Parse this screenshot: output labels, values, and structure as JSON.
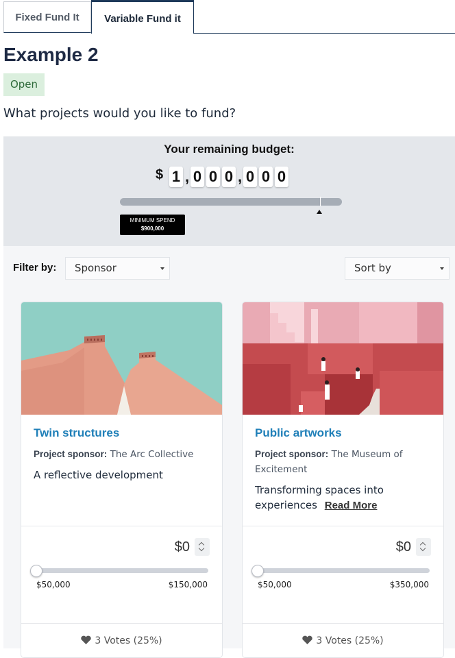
{
  "tabs": [
    {
      "label": "Fixed Fund It",
      "active": false
    },
    {
      "label": "Variable Fund it",
      "active": true
    }
  ],
  "page": {
    "title": "Example 2",
    "status": "Open",
    "question": "What projects would you like to fund?"
  },
  "budget": {
    "title": "Your remaining budget:",
    "currency": "$",
    "digits": [
      "1",
      ",",
      "0",
      "0",
      "0",
      ",",
      "0",
      "0",
      "0"
    ],
    "min_spend_label": "MINIMUM SPEND",
    "min_spend_value": "$900,000",
    "min_spend_fraction": 0.9
  },
  "filters": {
    "label": "Filter by:",
    "sponsor": "Sponsor",
    "sort": "Sort by"
  },
  "projects": [
    {
      "title": "Twin structures",
      "sponsor_label": "Project sponsor:",
      "sponsor": "The Arc Collective",
      "description": "A reflective development",
      "read_more": "",
      "amount": "$0",
      "range_min": "$50,000",
      "range_max": "$150,000",
      "slider_fraction": 0,
      "votes": "3 Votes (25%)",
      "image": "pink-buildings-photo"
    },
    {
      "title": "Public artworks",
      "sponsor_label": "Project sponsor:",
      "sponsor": "The Museum of Excitement",
      "description": "Transforming spaces into experiences",
      "read_more": "Read More",
      "amount": "$0",
      "range_min": "$50,000",
      "range_max": "$350,000",
      "slider_fraction": 0,
      "votes": "3 Votes (25%)",
      "image": "red-stairs-photo"
    }
  ],
  "colors": {
    "primary": "#1e3a5a",
    "link": "#1f7fb8",
    "badge_bg": "#dbefde",
    "panel_bg": "#e4e7eb"
  }
}
